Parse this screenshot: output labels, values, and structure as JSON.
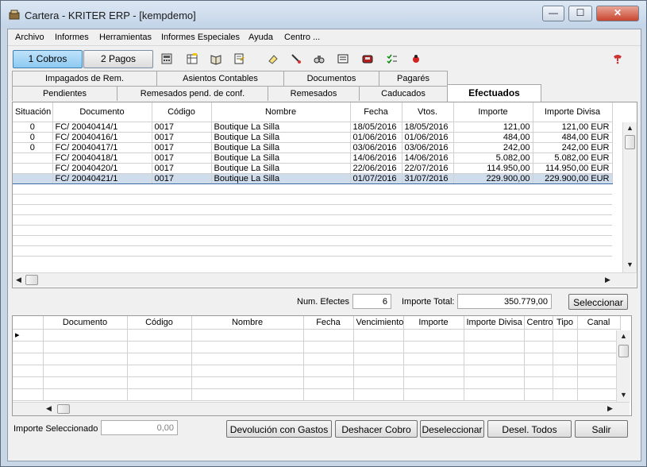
{
  "window": {
    "title": "Cartera - KRITER ERP - [kempdemo]",
    "buttons": {
      "min": "—",
      "max": "☐",
      "close": "✕"
    }
  },
  "menu": [
    "Archivo",
    "Informes",
    "Herramientas",
    "Informes Especiales",
    "Ayuda",
    "Centro ..."
  ],
  "modes": {
    "cobros": "1 Cobros",
    "pagos": "2 Pagos"
  },
  "toolbar_icons": [
    "calculator-icon",
    "spreadsheet-icon",
    "book-icon",
    "notebook-icon",
    "eraser-icon",
    "pen-icon",
    "binoculars-icon",
    "card-icon",
    "phone-icon",
    "checklist-icon",
    "ladybug-icon",
    "help-icon"
  ],
  "tabs_row1": [
    "Impagados de Rem.",
    "Asientos Contables",
    "Documentos",
    "Pagarés"
  ],
  "tabs_row2": [
    "Pendientes",
    "Remesados pend. de conf.",
    "Remesados",
    "Caducados",
    "Efectuados"
  ],
  "active_tab": "Efectuados",
  "grid": {
    "columns": [
      "Situación",
      "Documento",
      "Código",
      "Nombre",
      "Fecha",
      "Vtos.",
      "Importe",
      "Importe Divisa"
    ],
    "rows": [
      [
        "0",
        "FC/ 20040414/1",
        "0017",
        "Boutique La Silla",
        "18/05/2016",
        "18/05/2016",
        "121,00",
        "121,00 EUR"
      ],
      [
        "0",
        "FC/ 20040416/1",
        "0017",
        "Boutique La Silla",
        "01/06/2016",
        "01/06/2016",
        "484,00",
        "484,00 EUR"
      ],
      [
        "0",
        "FC/ 20040417/1",
        "0017",
        "Boutique La Silla",
        "03/06/2016",
        "03/06/2016",
        "242,00",
        "242,00 EUR"
      ],
      [
        "",
        "FC/ 20040418/1",
        "0017",
        "Boutique La Silla",
        "14/06/2016",
        "14/06/2016",
        "5.082,00",
        "5.082,00 EUR"
      ],
      [
        "",
        "FC/ 20040420/1",
        "0017",
        "Boutique La Silla",
        "22/06/2016",
        "22/07/2016",
        "114.950,00",
        "114.950,00 EUR"
      ],
      [
        "",
        "FC/ 20040421/1",
        "0017",
        "Boutique La Silla",
        "01/07/2016",
        "31/07/2016",
        "229.900,00",
        "229.900,00 EUR"
      ]
    ],
    "selected_row": 5
  },
  "summary": {
    "num_label": "Num. Efectes",
    "num_value": "6",
    "total_label": "Importe Total:",
    "total_value": "350.779,00",
    "select_button": "Seleccionar"
  },
  "grid2": {
    "columns": [
      "Documento",
      "Código",
      "Nombre",
      "Fecha",
      "Vencimiento",
      "Importe",
      "Importe Divisa",
      "Centro",
      "Tipo",
      "Canal"
    ]
  },
  "footer": {
    "importe_label": "Importe Seleccionado",
    "importe_value": "0,00",
    "buttons": [
      "Devolución con Gastos",
      "Deshacer Cobro",
      "Deseleccionar",
      "Desel. Todos",
      "Salir"
    ]
  }
}
